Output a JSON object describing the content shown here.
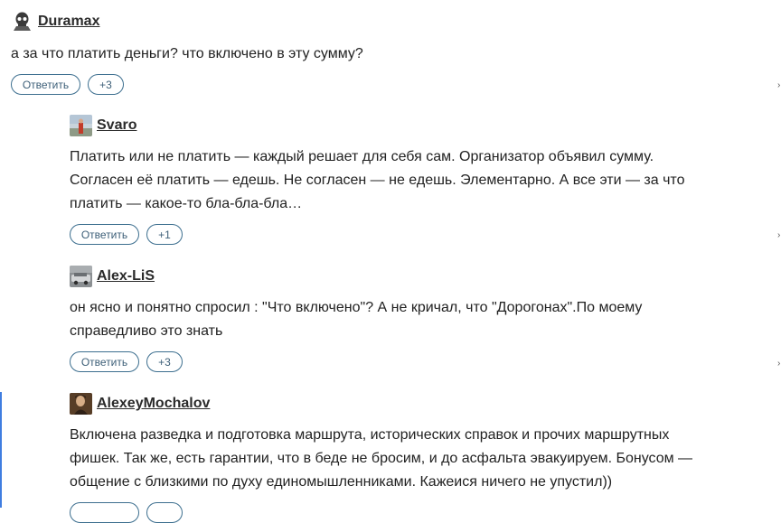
{
  "comments": [
    {
      "author": "Duramax",
      "text": "а за что платить деньги? что включено в эту сумму?",
      "reply_label": "Ответить",
      "votes": "+3"
    },
    {
      "author": "Svaro",
      "text_lines": [
        "Платить или не платить — каждый решает для себя сам. Организатор объявил сумму.",
        "Согласен её платить — едешь. Не согласен — не едешь. Элементарно. А все эти — за что",
        "платить — какое-то бла-бла-бла…"
      ],
      "reply_label": "Ответить",
      "votes": "+1"
    },
    {
      "author": "Alex-LiS",
      "text_lines": [
        "он ясно и понятно спросил : \"Что включено\"? А не кричал, что \"Дорогонах\".По моему",
        "справедливо это знать"
      ],
      "reply_label": "Ответить",
      "votes": "+3"
    },
    {
      "author": "AlexeyMochalov",
      "text_lines": [
        "Включена разведка и подготовка маршрута, исторических справок и прочих маршрутных",
        "фишек. Так же, есть гарантии, что в беде не бросим, и до асфальта эвакуируем. Бонусом —",
        "общение с близкими по духу единомышленниками. Кажеися ничего не упустил))"
      ]
    }
  ]
}
